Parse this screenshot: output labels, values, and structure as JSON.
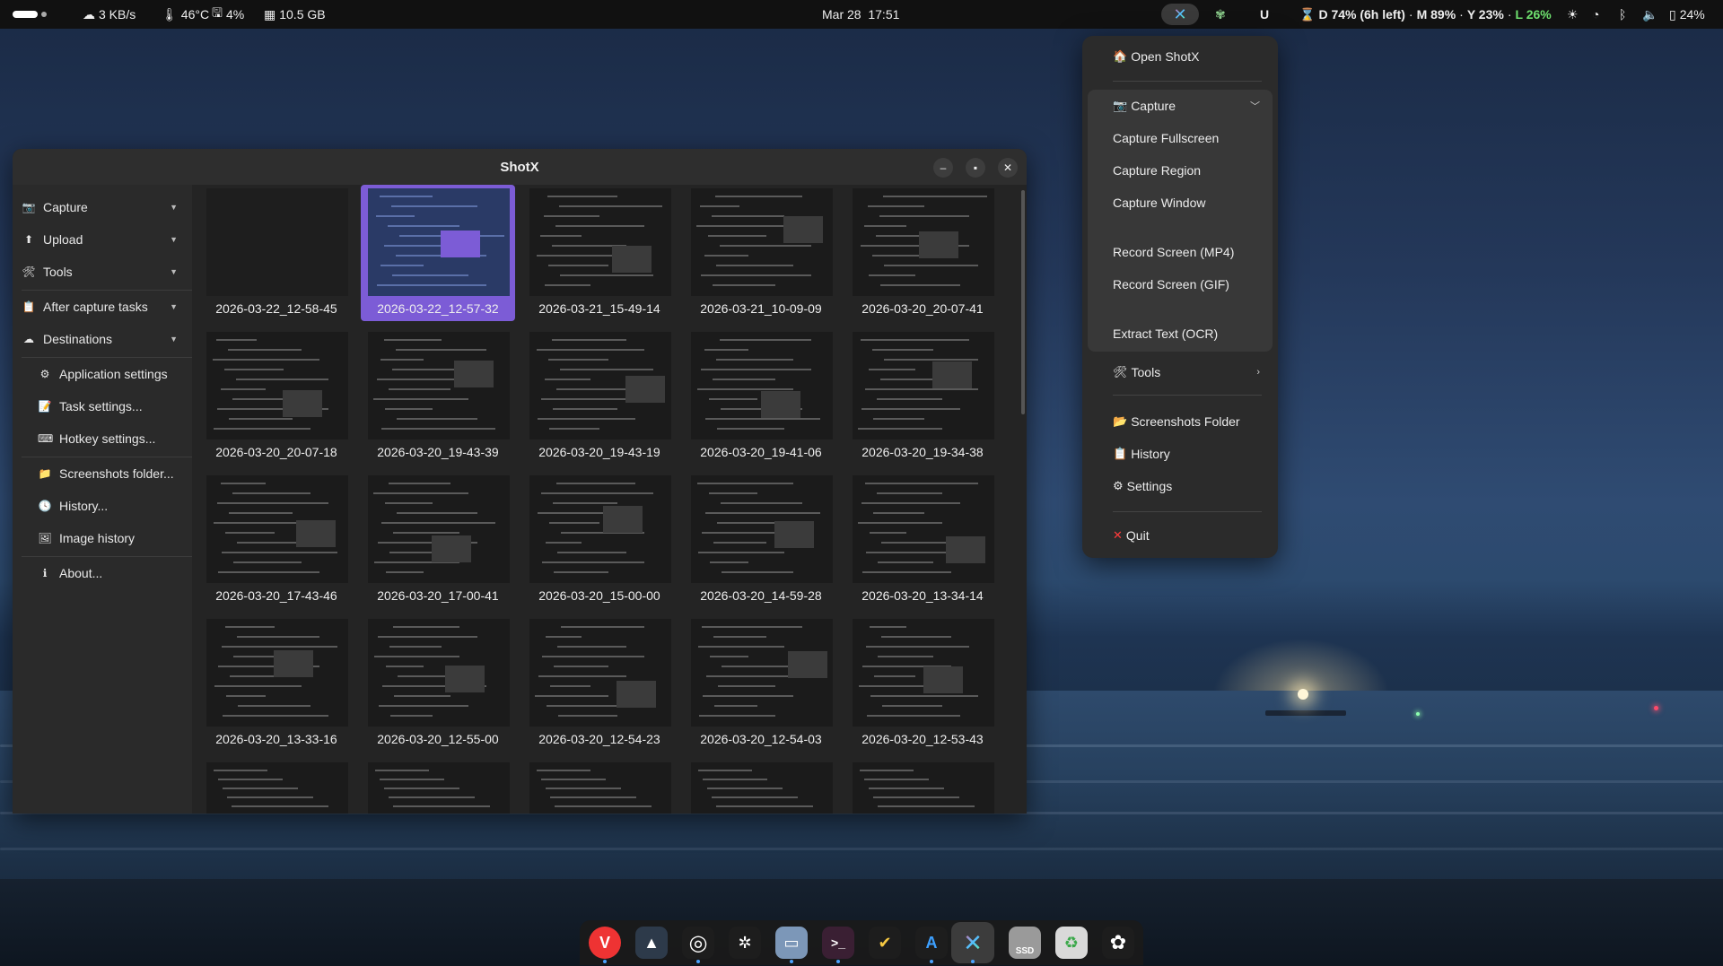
{
  "topbar": {
    "network": "3 KB/s",
    "temp": "46°C",
    "disk_pct": "4%",
    "memory": "10.5 GB",
    "datetime": "Mar 28  17:51",
    "usage_d": "D 74% (6h left)",
    "usage_m": "M 89%",
    "usage_y": "Y 23%",
    "usage_l": "L 26%",
    "battery": "24%"
  },
  "window": {
    "title": "ShotX"
  },
  "sidebar": {
    "items": [
      {
        "label": "Capture",
        "icon": "camera-icon"
      },
      {
        "label": "Upload",
        "icon": "upload-icon"
      },
      {
        "label": "Tools",
        "icon": "tools-icon"
      },
      {
        "label": "After capture tasks",
        "icon": "clipboard-icon"
      },
      {
        "label": "Destinations",
        "icon": "cloud-icon"
      },
      {
        "label": "Application settings",
        "icon": "gear-icon"
      },
      {
        "label": "Task settings...",
        "icon": "memo-icon"
      },
      {
        "label": "Hotkey settings...",
        "icon": "keyboard-icon"
      },
      {
        "label": "Screenshots folder...",
        "icon": "folder-icon"
      },
      {
        "label": "History...",
        "icon": "clock-icon"
      },
      {
        "label": "Image history",
        "icon": "image-icon"
      },
      {
        "label": "About...",
        "icon": "info-icon"
      }
    ]
  },
  "screenshots": [
    "2026-03-22_12-58-45",
    "2026-03-22_12-57-32",
    "2026-03-21_15-49-14",
    "2026-03-21_10-09-09",
    "2026-03-20_20-07-41",
    "2026-03-20_20-07-18",
    "2026-03-20_19-43-39",
    "2026-03-20_19-43-19",
    "2026-03-20_19-41-06",
    "2026-03-20_19-34-38",
    "2026-03-20_17-43-46",
    "2026-03-20_17-00-41",
    "2026-03-20_15-00-00",
    "2026-03-20_14-59-28",
    "2026-03-20_13-34-14",
    "2026-03-20_13-33-16",
    "2026-03-20_12-55-00",
    "2026-03-20_12-54-23",
    "2026-03-20_12-54-03",
    "2026-03-20_12-53-43"
  ],
  "tray_menu": {
    "open": "Open ShotX",
    "capture": "Capture",
    "capture_fullscreen": "Capture Fullscreen",
    "capture_region": "Capture Region",
    "capture_window": "Capture Window",
    "record_mp4": "Record Screen (MP4)",
    "record_gif": "Record Screen (GIF)",
    "ocr": "Extract Text (OCR)",
    "tools": "Tools",
    "screenshots_folder": "Screenshots Folder",
    "history": "History",
    "settings": "Settings",
    "quit": "Quit"
  },
  "dock": {
    "apps": [
      "vivaldi-icon",
      "arch-icon",
      "target-icon",
      "network-icon",
      "files-icon",
      "terminal-icon",
      "check-icon",
      "text-editor-icon",
      "shotx-icon",
      "ssd-icon",
      "trash-icon",
      "settings-icon"
    ],
    "ssd_label": "SSD"
  }
}
